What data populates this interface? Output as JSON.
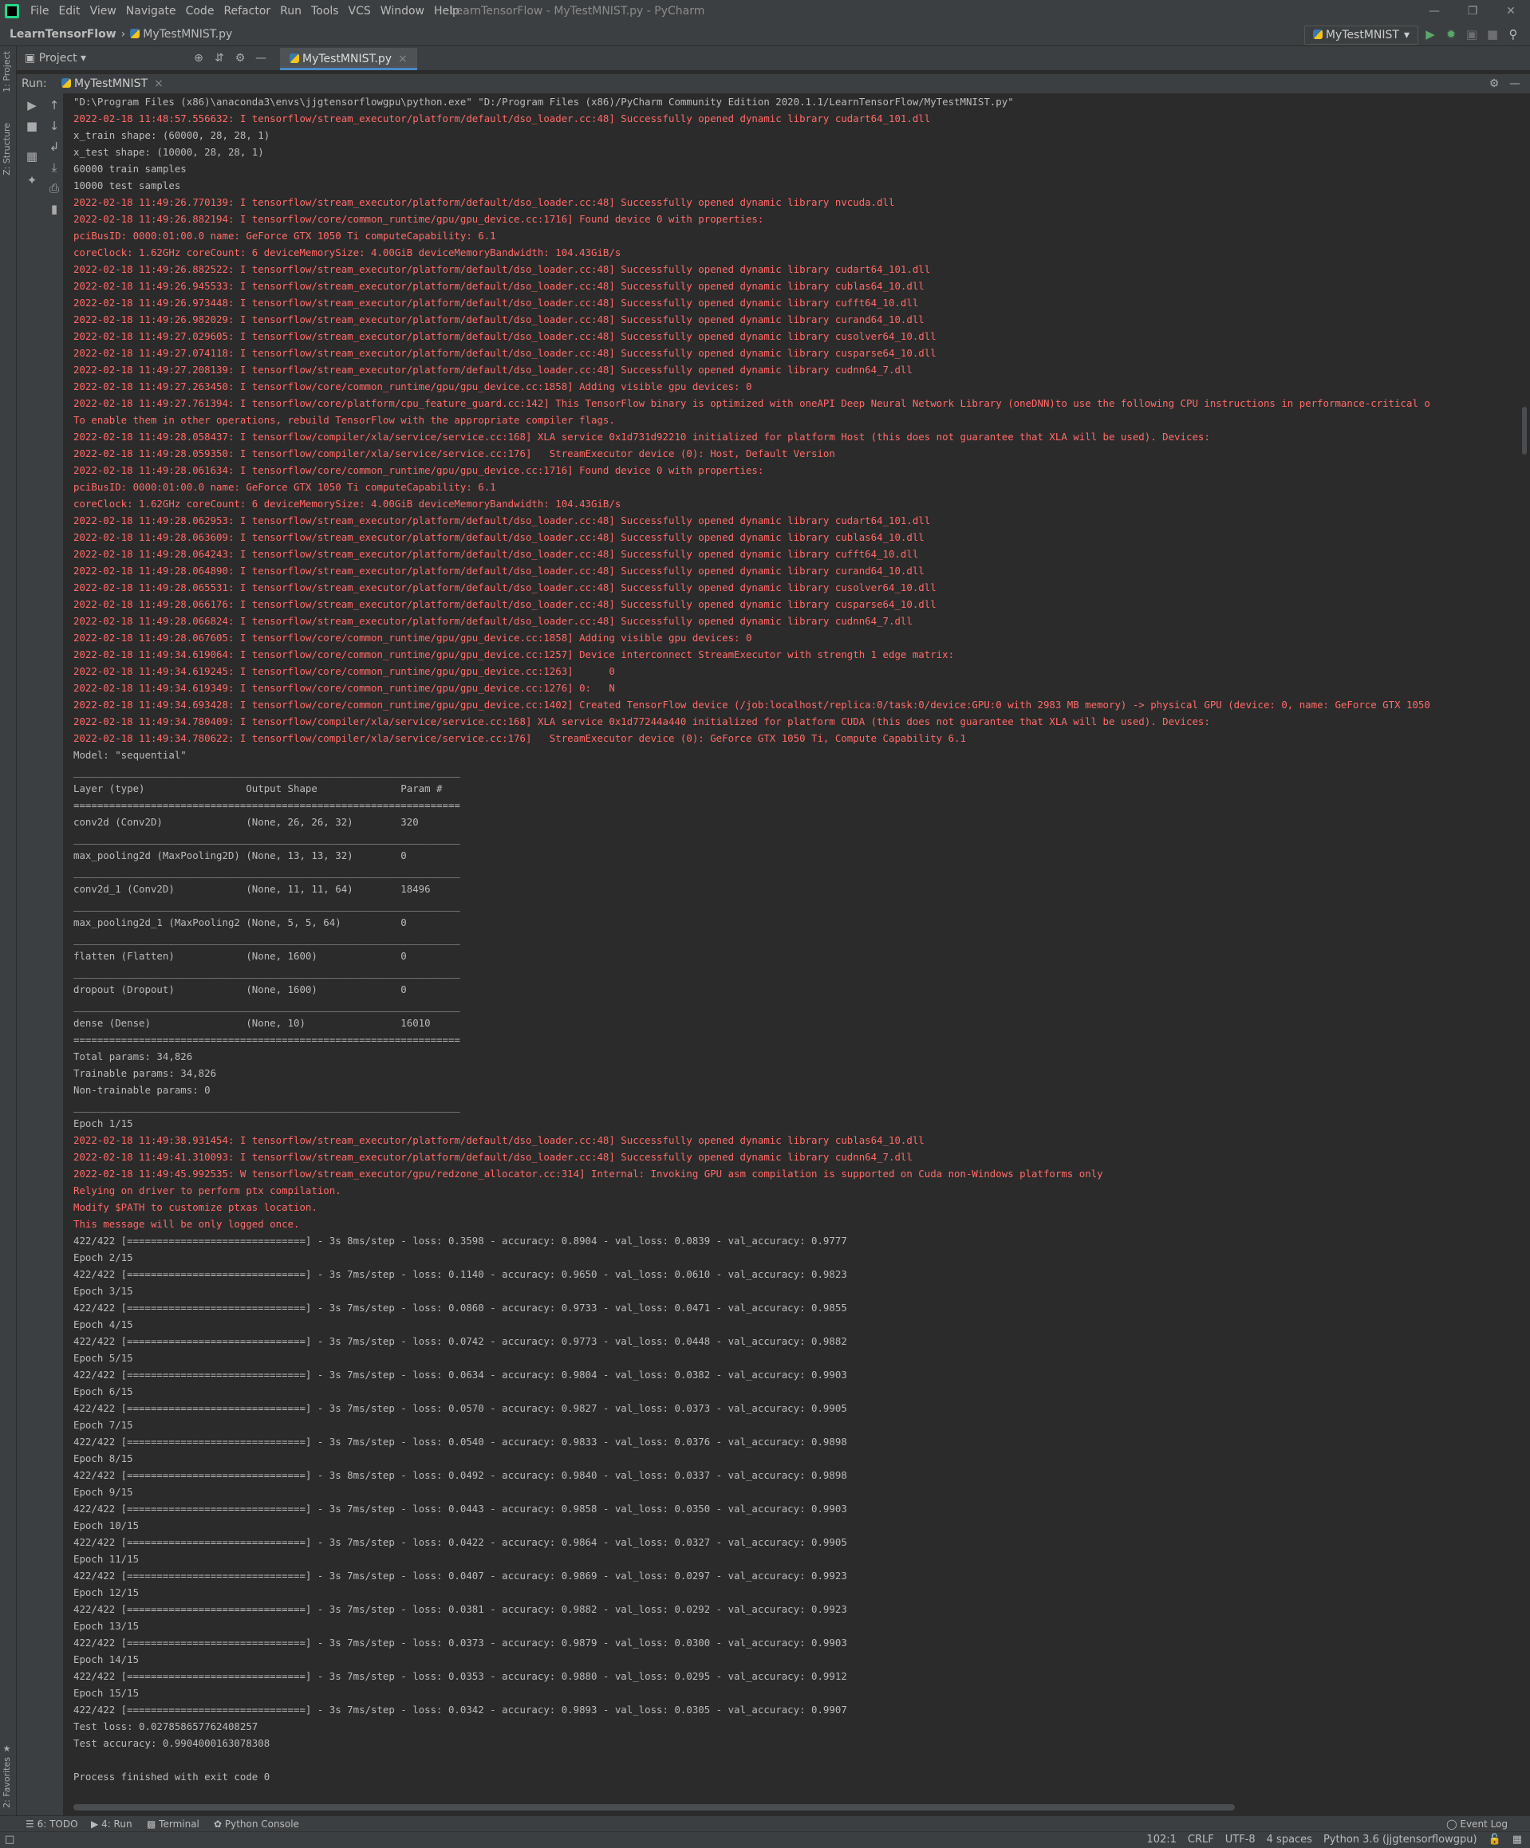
{
  "menu": [
    "File",
    "Edit",
    "View",
    "Navigate",
    "Code",
    "Refactor",
    "Run",
    "Tools",
    "VCS",
    "Window",
    "Help"
  ],
  "window_title": "LearnTensorFlow - MyTestMNIST.py - PyCharm",
  "breadcrumb": {
    "project": "LearnTensorFlow",
    "file": "MyTestMNIST.py"
  },
  "run_config": "MyTestMNIST",
  "side_tabs": {
    "project": "1: Project",
    "structure": "Z: Structure",
    "favorites": "2: Favorites"
  },
  "project_panel": {
    "label": "Project",
    "file_tab": "MyTestMNIST.py"
  },
  "run_panel": {
    "label": "Run:",
    "tab": "MyTestMNIST"
  },
  "console_lines": [
    {
      "t": "\"D:\\Program Files (x86)\\anaconda3\\envs\\jjgtensorflowgpu\\python.exe\" \"D:/Program Files (x86)/PyCharm Community Edition 2020.1.1/LearnTensorFlow/MyTestMNIST.py\"",
      "s": "n"
    },
    {
      "t": "2022-02-18 11:48:57.556632: I tensorflow/stream_executor/platform/default/dso_loader.cc:48] Successfully opened dynamic library cudart64_101.dll",
      "s": "e"
    },
    {
      "t": "x_train shape: (60000, 28, 28, 1)",
      "s": "n"
    },
    {
      "t": "x_test shape: (10000, 28, 28, 1)",
      "s": "n"
    },
    {
      "t": "60000 train samples",
      "s": "n"
    },
    {
      "t": "10000 test samples",
      "s": "n"
    },
    {
      "t": "2022-02-18 11:49:26.770139: I tensorflow/stream_executor/platform/default/dso_loader.cc:48] Successfully opened dynamic library nvcuda.dll",
      "s": "e"
    },
    {
      "t": "2022-02-18 11:49:26.882194: I tensorflow/core/common_runtime/gpu/gpu_device.cc:1716] Found device 0 with properties:",
      "s": "e"
    },
    {
      "t": "pciBusID: 0000:01:00.0 name: GeForce GTX 1050 Ti computeCapability: 6.1",
      "s": "e"
    },
    {
      "t": "coreClock: 1.62GHz coreCount: 6 deviceMemorySize: 4.00GiB deviceMemoryBandwidth: 104.43GiB/s",
      "s": "e"
    },
    {
      "t": "2022-02-18 11:49:26.882522: I tensorflow/stream_executor/platform/default/dso_loader.cc:48] Successfully opened dynamic library cudart64_101.dll",
      "s": "e"
    },
    {
      "t": "2022-02-18 11:49:26.945533: I tensorflow/stream_executor/platform/default/dso_loader.cc:48] Successfully opened dynamic library cublas64_10.dll",
      "s": "e"
    },
    {
      "t": "2022-02-18 11:49:26.973448: I tensorflow/stream_executor/platform/default/dso_loader.cc:48] Successfully opened dynamic library cufft64_10.dll",
      "s": "e"
    },
    {
      "t": "2022-02-18 11:49:26.982029: I tensorflow/stream_executor/platform/default/dso_loader.cc:48] Successfully opened dynamic library curand64_10.dll",
      "s": "e"
    },
    {
      "t": "2022-02-18 11:49:27.029605: I tensorflow/stream_executor/platform/default/dso_loader.cc:48] Successfully opened dynamic library cusolver64_10.dll",
      "s": "e"
    },
    {
      "t": "2022-02-18 11:49:27.074118: I tensorflow/stream_executor/platform/default/dso_loader.cc:48] Successfully opened dynamic library cusparse64_10.dll",
      "s": "e"
    },
    {
      "t": "2022-02-18 11:49:27.208139: I tensorflow/stream_executor/platform/default/dso_loader.cc:48] Successfully opened dynamic library cudnn64_7.dll",
      "s": "e"
    },
    {
      "t": "2022-02-18 11:49:27.263450: I tensorflow/core/common_runtime/gpu/gpu_device.cc:1858] Adding visible gpu devices: 0",
      "s": "e"
    },
    {
      "t": "2022-02-18 11:49:27.761394: I tensorflow/core/platform/cpu_feature_guard.cc:142] This TensorFlow binary is optimized with oneAPI Deep Neural Network Library (oneDNN)to use the following CPU instructions in performance-critical o",
      "s": "e"
    },
    {
      "t": "To enable them in other operations, rebuild TensorFlow with the appropriate compiler flags.",
      "s": "e"
    },
    {
      "t": "2022-02-18 11:49:28.058437: I tensorflow/compiler/xla/service/service.cc:168] XLA service 0x1d731d92210 initialized for platform Host (this does not guarantee that XLA will be used). Devices:",
      "s": "e"
    },
    {
      "t": "2022-02-18 11:49:28.059350: I tensorflow/compiler/xla/service/service.cc:176]   StreamExecutor device (0): Host, Default Version",
      "s": "e"
    },
    {
      "t": "2022-02-18 11:49:28.061634: I tensorflow/core/common_runtime/gpu/gpu_device.cc:1716] Found device 0 with properties:",
      "s": "e"
    },
    {
      "t": "pciBusID: 0000:01:00.0 name: GeForce GTX 1050 Ti computeCapability: 6.1",
      "s": "e"
    },
    {
      "t": "coreClock: 1.62GHz coreCount: 6 deviceMemorySize: 4.00GiB deviceMemoryBandwidth: 104.43GiB/s",
      "s": "e"
    },
    {
      "t": "2022-02-18 11:49:28.062953: I tensorflow/stream_executor/platform/default/dso_loader.cc:48] Successfully opened dynamic library cudart64_101.dll",
      "s": "e"
    },
    {
      "t": "2022-02-18 11:49:28.063609: I tensorflow/stream_executor/platform/default/dso_loader.cc:48] Successfully opened dynamic library cublas64_10.dll",
      "s": "e"
    },
    {
      "t": "2022-02-18 11:49:28.064243: I tensorflow/stream_executor/platform/default/dso_loader.cc:48] Successfully opened dynamic library cufft64_10.dll",
      "s": "e"
    },
    {
      "t": "2022-02-18 11:49:28.064890: I tensorflow/stream_executor/platform/default/dso_loader.cc:48] Successfully opened dynamic library curand64_10.dll",
      "s": "e"
    },
    {
      "t": "2022-02-18 11:49:28.065531: I tensorflow/stream_executor/platform/default/dso_loader.cc:48] Successfully opened dynamic library cusolver64_10.dll",
      "s": "e"
    },
    {
      "t": "2022-02-18 11:49:28.066176: I tensorflow/stream_executor/platform/default/dso_loader.cc:48] Successfully opened dynamic library cusparse64_10.dll",
      "s": "e"
    },
    {
      "t": "2022-02-18 11:49:28.066824: I tensorflow/stream_executor/platform/default/dso_loader.cc:48] Successfully opened dynamic library cudnn64_7.dll",
      "s": "e"
    },
    {
      "t": "2022-02-18 11:49:28.067605: I tensorflow/core/common_runtime/gpu/gpu_device.cc:1858] Adding visible gpu devices: 0",
      "s": "e"
    },
    {
      "t": "2022-02-18 11:49:34.619064: I tensorflow/core/common_runtime/gpu/gpu_device.cc:1257] Device interconnect StreamExecutor with strength 1 edge matrix:",
      "s": "e"
    },
    {
      "t": "2022-02-18 11:49:34.619245: I tensorflow/core/common_runtime/gpu/gpu_device.cc:1263]      0",
      "s": "e"
    },
    {
      "t": "2022-02-18 11:49:34.619349: I tensorflow/core/common_runtime/gpu/gpu_device.cc:1276] 0:   N",
      "s": "e"
    },
    {
      "t": "2022-02-18 11:49:34.693428: I tensorflow/core/common_runtime/gpu/gpu_device.cc:1402] Created TensorFlow device (/job:localhost/replica:0/task:0/device:GPU:0 with 2983 MB memory) -> physical GPU (device: 0, name: GeForce GTX 1050",
      "s": "e"
    },
    {
      "t": "2022-02-18 11:49:34.780409: I tensorflow/compiler/xla/service/service.cc:168] XLA service 0x1d77244a440 initialized for platform CUDA (this does not guarantee that XLA will be used). Devices:",
      "s": "e"
    },
    {
      "t": "2022-02-18 11:49:34.780622: I tensorflow/compiler/xla/service/service.cc:176]   StreamExecutor device (0): GeForce GTX 1050 Ti, Compute Capability 6.1",
      "s": "e"
    },
    {
      "t": "Model: \"sequential\"",
      "s": "n"
    },
    {
      "t": "_________________________________________________________________",
      "s": "n"
    },
    {
      "t": "Layer (type)                 Output Shape              Param #",
      "s": "n"
    },
    {
      "t": "=================================================================",
      "s": "n"
    },
    {
      "t": "conv2d (Conv2D)              (None, 26, 26, 32)        320",
      "s": "n"
    },
    {
      "t": "_________________________________________________________________",
      "s": "n"
    },
    {
      "t": "max_pooling2d (MaxPooling2D) (None, 13, 13, 32)        0",
      "s": "n"
    },
    {
      "t": "_________________________________________________________________",
      "s": "n"
    },
    {
      "t": "conv2d_1 (Conv2D)            (None, 11, 11, 64)        18496",
      "s": "n"
    },
    {
      "t": "_________________________________________________________________",
      "s": "n"
    },
    {
      "t": "max_pooling2d_1 (MaxPooling2 (None, 5, 5, 64)          0",
      "s": "n"
    },
    {
      "t": "_________________________________________________________________",
      "s": "n"
    },
    {
      "t": "flatten (Flatten)            (None, 1600)              0",
      "s": "n"
    },
    {
      "t": "_________________________________________________________________",
      "s": "n"
    },
    {
      "t": "dropout (Dropout)            (None, 1600)              0",
      "s": "n"
    },
    {
      "t": "_________________________________________________________________",
      "s": "n"
    },
    {
      "t": "dense (Dense)                (None, 10)                16010",
      "s": "n"
    },
    {
      "t": "=================================================================",
      "s": "n"
    },
    {
      "t": "Total params: 34,826",
      "s": "n"
    },
    {
      "t": "Trainable params: 34,826",
      "s": "n"
    },
    {
      "t": "Non-trainable params: 0",
      "s": "n"
    },
    {
      "t": "_________________________________________________________________",
      "s": "n"
    },
    {
      "t": "Epoch 1/15",
      "s": "n"
    },
    {
      "t": "2022-02-18 11:49:38.931454: I tensorflow/stream_executor/platform/default/dso_loader.cc:48] Successfully opened dynamic library cublas64_10.dll",
      "s": "e"
    },
    {
      "t": "2022-02-18 11:49:41.310093: I tensorflow/stream_executor/platform/default/dso_loader.cc:48] Successfully opened dynamic library cudnn64_7.dll",
      "s": "e"
    },
    {
      "t": "2022-02-18 11:49:45.992535: W tensorflow/stream_executor/gpu/redzone_allocator.cc:314] Internal: Invoking GPU asm compilation is supported on Cuda non-Windows platforms only",
      "s": "e"
    },
    {
      "t": "Relying on driver to perform ptx compilation.",
      "s": "e"
    },
    {
      "t": "Modify $PATH to customize ptxas location.",
      "s": "e"
    },
    {
      "t": "This message will be only logged once.",
      "s": "e"
    },
    {
      "t": "422/422 [==============================] - 3s 8ms/step - loss: 0.3598 - accuracy: 0.8904 - val_loss: 0.0839 - val_accuracy: 0.9777",
      "s": "n"
    },
    {
      "t": "Epoch 2/15",
      "s": "n"
    },
    {
      "t": "422/422 [==============================] - 3s 7ms/step - loss: 0.1140 - accuracy: 0.9650 - val_loss: 0.0610 - val_accuracy: 0.9823",
      "s": "n"
    },
    {
      "t": "Epoch 3/15",
      "s": "n"
    },
    {
      "t": "422/422 [==============================] - 3s 7ms/step - loss: 0.0860 - accuracy: 0.9733 - val_loss: 0.0471 - val_accuracy: 0.9855",
      "s": "n"
    },
    {
      "t": "Epoch 4/15",
      "s": "n"
    },
    {
      "t": "422/422 [==============================] - 3s 7ms/step - loss: 0.0742 - accuracy: 0.9773 - val_loss: 0.0448 - val_accuracy: 0.9882",
      "s": "n"
    },
    {
      "t": "Epoch 5/15",
      "s": "n"
    },
    {
      "t": "422/422 [==============================] - 3s 7ms/step - loss: 0.0634 - accuracy: 0.9804 - val_loss: 0.0382 - val_accuracy: 0.9903",
      "s": "n"
    },
    {
      "t": "Epoch 6/15",
      "s": "n"
    },
    {
      "t": "422/422 [==============================] - 3s 7ms/step - loss: 0.0570 - accuracy: 0.9827 - val_loss: 0.0373 - val_accuracy: 0.9905",
      "s": "n"
    },
    {
      "t": "Epoch 7/15",
      "s": "n"
    },
    {
      "t": "422/422 [==============================] - 3s 7ms/step - loss: 0.0540 - accuracy: 0.9833 - val_loss: 0.0376 - val_accuracy: 0.9898",
      "s": "n"
    },
    {
      "t": "Epoch 8/15",
      "s": "n"
    },
    {
      "t": "422/422 [==============================] - 3s 8ms/step - loss: 0.0492 - accuracy: 0.9840 - val_loss: 0.0337 - val_accuracy: 0.9898",
      "s": "n"
    },
    {
      "t": "Epoch 9/15",
      "s": "n"
    },
    {
      "t": "422/422 [==============================] - 3s 7ms/step - loss: 0.0443 - accuracy: 0.9858 - val_loss: 0.0350 - val_accuracy: 0.9903",
      "s": "n"
    },
    {
      "t": "Epoch 10/15",
      "s": "n"
    },
    {
      "t": "422/422 [==============================] - 3s 7ms/step - loss: 0.0422 - accuracy: 0.9864 - val_loss: 0.0327 - val_accuracy: 0.9905",
      "s": "n"
    },
    {
      "t": "Epoch 11/15",
      "s": "n"
    },
    {
      "t": "422/422 [==============================] - 3s 7ms/step - loss: 0.0407 - accuracy: 0.9869 - val_loss: 0.0297 - val_accuracy: 0.9923",
      "s": "n"
    },
    {
      "t": "Epoch 12/15",
      "s": "n"
    },
    {
      "t": "422/422 [==============================] - 3s 7ms/step - loss: 0.0381 - accuracy: 0.9882 - val_loss: 0.0292 - val_accuracy: 0.9923",
      "s": "n"
    },
    {
      "t": "Epoch 13/15",
      "s": "n"
    },
    {
      "t": "422/422 [==============================] - 3s 7ms/step - loss: 0.0373 - accuracy: 0.9879 - val_loss: 0.0300 - val_accuracy: 0.9903",
      "s": "n"
    },
    {
      "t": "Epoch 14/15",
      "s": "n"
    },
    {
      "t": "422/422 [==============================] - 3s 7ms/step - loss: 0.0353 - accuracy: 0.9880 - val_loss: 0.0295 - val_accuracy: 0.9912",
      "s": "n"
    },
    {
      "t": "Epoch 15/15",
      "s": "n"
    },
    {
      "t": "422/422 [==============================] - 3s 7ms/step - loss: 0.0342 - accuracy: 0.9893 - val_loss: 0.0305 - val_accuracy: 0.9907",
      "s": "n"
    },
    {
      "t": "Test loss: 0.027858657762408257",
      "s": "n"
    },
    {
      "t": "Test accuracy: 0.9904000163078308",
      "s": "n"
    },
    {
      "t": "",
      "s": "n"
    },
    {
      "t": "Process finished with exit code 0",
      "s": "n"
    }
  ],
  "bottom_tabs": [
    "6: TODO",
    "4: Run",
    "Terminal",
    "Python Console"
  ],
  "event_log": "Event Log",
  "status": {
    "position": "102:1",
    "line_sep": "CRLF",
    "encoding": "UTF-8",
    "indent": "4 spaces",
    "interpreter": "Python 3.6 (jjgtensorflowgpu)"
  },
  "colors": {
    "bg": "#2b2b2b",
    "panel": "#3c3f41",
    "text": "#bbbbbb",
    "stderr": "#ff6b68",
    "accent": "#4a88c7",
    "run_green": "#59a869"
  },
  "icons": [
    "pycharm-logo-icon",
    "python-file-icon",
    "run-icon",
    "debug-icon",
    "coverage-icon",
    "stop-icon",
    "search-icon",
    "locate-icon",
    "collapse-icon",
    "gear-icon",
    "minimize-icon",
    "rerun-icon",
    "scroll-up-icon",
    "scroll-down-icon",
    "soft-wrap-icon",
    "scroll-to-end-icon",
    "print-icon",
    "trash-icon",
    "layout-icon",
    "pin-icon",
    "folder-icon",
    "structure-icon",
    "favorites-star-icon",
    "todo-icon",
    "terminal-icon",
    "python-console-icon",
    "event-log-icon",
    "lock-icon",
    "notifications-icon"
  ]
}
